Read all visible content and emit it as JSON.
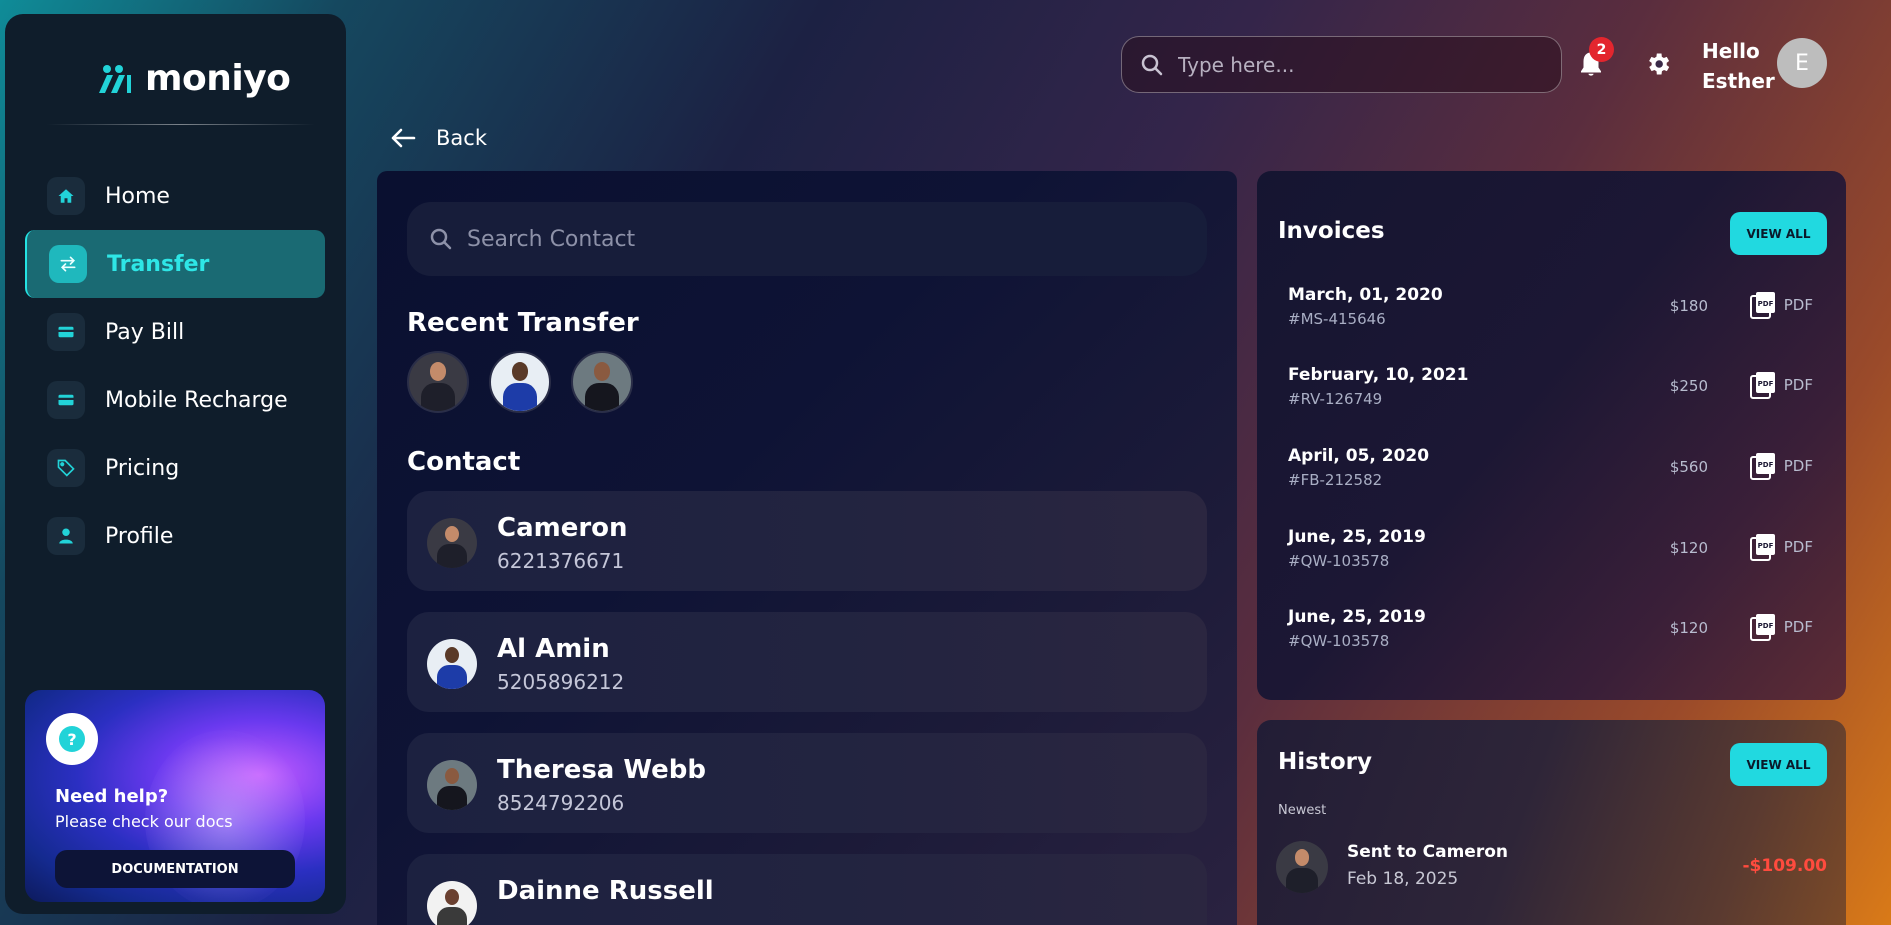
{
  "brand": {
    "name": "moniyo"
  },
  "sidebar": {
    "items": [
      {
        "label": "Home",
        "icon": "home-icon"
      },
      {
        "label": "Transfer",
        "icon": "transfer-icon",
        "active": true
      },
      {
        "label": "Pay Bill",
        "icon": "card-icon"
      },
      {
        "label": "Mobile Recharge",
        "icon": "card-icon"
      },
      {
        "label": "Pricing",
        "icon": "tag-icon"
      },
      {
        "label": "Profile",
        "icon": "user-icon"
      }
    ],
    "help": {
      "title": "Need help?",
      "subtitle": "Please check our docs",
      "button": "DOCUMENTATION"
    }
  },
  "header": {
    "search_placeholder": "Type here...",
    "notification_count": "2",
    "greeting_line1": "Hello",
    "greeting_line2": "Esther",
    "avatar_initial": "E"
  },
  "back_label": "Back",
  "transfer": {
    "search_placeholder": "Search Contact",
    "recent_title": "Recent Transfer",
    "contact_title": "Contact",
    "contacts": [
      {
        "name": "Cameron",
        "number": "6221376671"
      },
      {
        "name": "Al Amin",
        "number": "5205896212"
      },
      {
        "name": "Theresa Webb",
        "number": "8524792206"
      },
      {
        "name": "Dainne Russell",
        "number": ""
      }
    ]
  },
  "invoices": {
    "title": "Invoices",
    "view_all": "VIEW ALL",
    "items": [
      {
        "date": "March, 01, 2020",
        "id": "#MS-415646",
        "amount": "$180",
        "file": "PDF"
      },
      {
        "date": "February, 10, 2021",
        "id": "#RV-126749",
        "amount": "$250",
        "file": "PDF"
      },
      {
        "date": "April, 05, 2020",
        "id": "#FB-212582",
        "amount": "$560",
        "file": "PDF"
      },
      {
        "date": "June, 25, 2019",
        "id": "#QW-103578",
        "amount": "$120",
        "file": "PDF"
      },
      {
        "date": "June, 25, 2019",
        "id": "#QW-103578",
        "amount": "$120",
        "file": "PDF"
      }
    ]
  },
  "history": {
    "title": "History",
    "view_all": "VIEW ALL",
    "group": "Newest",
    "items": [
      {
        "name": "Sent to Cameron",
        "date": "Feb 18, 2025",
        "amount": "-$109.00"
      }
    ]
  },
  "colors": {
    "accent": "#21d9e0",
    "negative": "#ff4b3e",
    "badge": "#e3262e"
  }
}
